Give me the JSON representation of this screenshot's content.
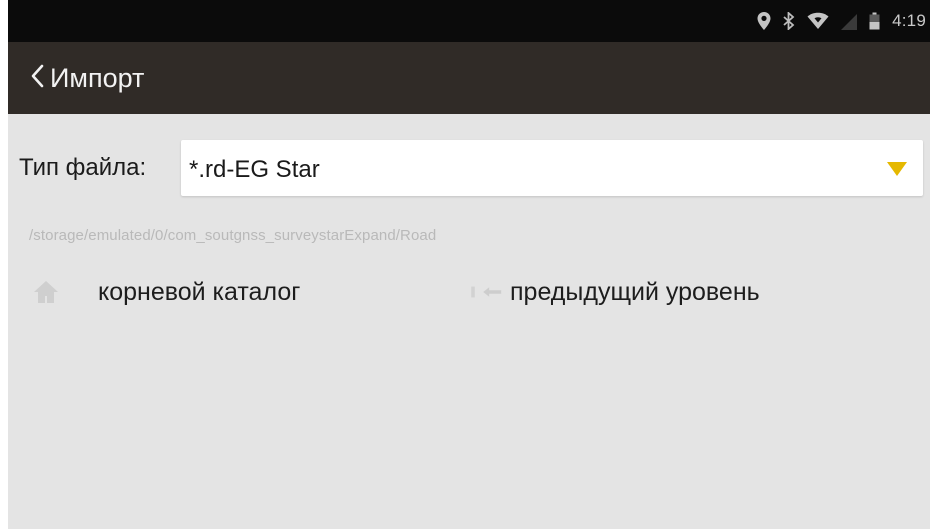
{
  "status_bar": {
    "time": "4:19",
    "icons": [
      "location-icon",
      "bluetooth-icon",
      "wifi-icon",
      "signal-icon",
      "battery-icon"
    ]
  },
  "toolbar": {
    "back_icon": "chevron-left-icon",
    "title": "Импорт"
  },
  "file_type": {
    "label": "Тип файла:",
    "selected": "*.rd-EG Star",
    "arrow_color": "#e5b800"
  },
  "path": "/storage/emulated/0/com_soutgnss_surveystarExpand/Road",
  "navigation": {
    "root": {
      "icon": "home-icon",
      "label": "корневой каталог"
    },
    "up": {
      "icon": "back-arrow-icon",
      "label": "предыдущий уровень"
    }
  },
  "colors": {
    "status_bar": "#0b0b0b",
    "toolbar": "#302b27",
    "background": "#e4e4e4",
    "accent": "#e5b800"
  }
}
